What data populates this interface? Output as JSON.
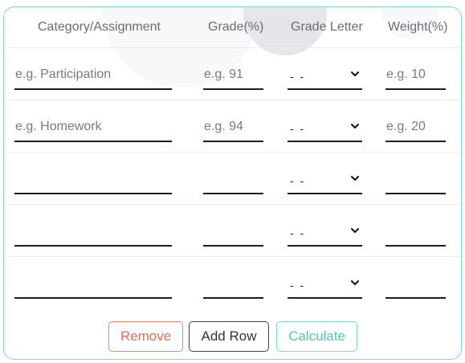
{
  "table": {
    "headers": {
      "category": "Category/Assignment",
      "grade": "Grade(%)",
      "letter": "Grade Letter",
      "weight": "Weight(%)"
    },
    "rows": [
      {
        "category_placeholder": "e.g. Participation",
        "grade_placeholder": "e.g. 91",
        "letter": "- -",
        "weight_placeholder": "e.g. 10"
      },
      {
        "category_placeholder": "e.g. Homework",
        "grade_placeholder": "e.g. 94",
        "letter": "- -",
        "weight_placeholder": "e.g. 20"
      },
      {
        "category_placeholder": "",
        "grade_placeholder": "",
        "letter": "- -",
        "weight_placeholder": ""
      },
      {
        "category_placeholder": "",
        "grade_placeholder": "",
        "letter": "- -",
        "weight_placeholder": ""
      },
      {
        "category_placeholder": "",
        "grade_placeholder": "",
        "letter": "- -",
        "weight_placeholder": ""
      }
    ]
  },
  "actions": {
    "remove": "Remove",
    "add_row": "Add Row",
    "calculate": "Calculate"
  },
  "colors": {
    "accent": "#7fdcc3",
    "remove": "#ec6d55",
    "add": "#333333",
    "calculate": "#55c7a6"
  },
  "icons": {
    "select_arrow": "chevron-down-icon"
  }
}
